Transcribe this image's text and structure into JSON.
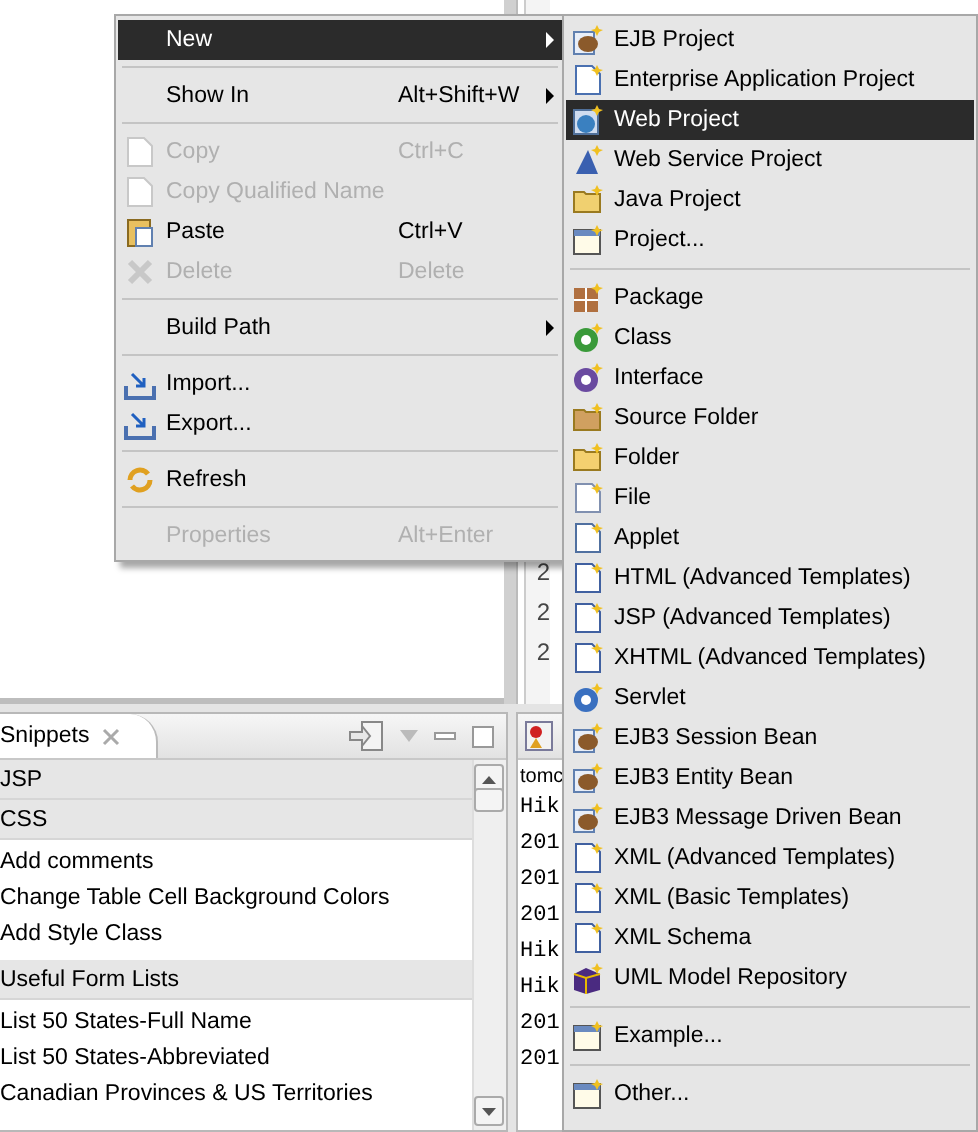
{
  "editor": {
    "line_numbers": [
      "2",
      "2",
      "2"
    ]
  },
  "snippets": {
    "title": "Snippets",
    "categories": [
      {
        "label": "JSP"
      },
      {
        "label": "CSS",
        "items": [
          "Add comments",
          "Change Table Cell Background Colors",
          "Add Style Class"
        ]
      },
      {
        "label": "Useful Form Lists",
        "items": [
          "List 50 States-Full Name",
          "List 50 States-Abbreviated",
          "Canadian Provinces & US Territories"
        ]
      }
    ]
  },
  "console": {
    "lines": [
      "tomc",
      "Hik",
      "201",
      "201",
      "201",
      "Hik",
      "Hik",
      "201",
      "201"
    ]
  },
  "context_menu": {
    "items": [
      {
        "kind": "item",
        "label": "New",
        "submenu": true,
        "disabled": false,
        "selected": true
      },
      {
        "kind": "separator"
      },
      {
        "kind": "item",
        "label": "Show In",
        "shortcut": "Alt+Shift+W",
        "submenu": true,
        "disabled": false,
        "selected": false
      },
      {
        "kind": "separator"
      },
      {
        "kind": "item",
        "label": "Copy",
        "shortcut": "Ctrl+C",
        "submenu": false,
        "disabled": true,
        "selected": false
      },
      {
        "kind": "item",
        "label": "Copy Qualified Name",
        "submenu": false,
        "disabled": true,
        "selected": false
      },
      {
        "kind": "item",
        "label": "Paste",
        "shortcut": "Ctrl+V",
        "submenu": false,
        "disabled": false,
        "selected": false
      },
      {
        "kind": "item",
        "label": "Delete",
        "shortcut": "Delete",
        "submenu": false,
        "disabled": true,
        "selected": false
      },
      {
        "kind": "separator"
      },
      {
        "kind": "item",
        "label": "Build Path",
        "submenu": true,
        "disabled": false,
        "selected": false
      },
      {
        "kind": "separator"
      },
      {
        "kind": "item",
        "label": "Import...",
        "submenu": false,
        "disabled": false,
        "selected": false
      },
      {
        "kind": "item",
        "label": "Export...",
        "submenu": false,
        "disabled": false,
        "selected": false
      },
      {
        "kind": "separator"
      },
      {
        "kind": "item",
        "label": "Refresh",
        "submenu": false,
        "disabled": false,
        "selected": false
      },
      {
        "kind": "separator"
      },
      {
        "kind": "item",
        "label": "Properties",
        "shortcut": "Alt+Enter",
        "submenu": false,
        "disabled": true,
        "selected": false
      }
    ]
  },
  "new_submenu": {
    "items": [
      {
        "kind": "item",
        "label": "EJB Project",
        "selected": false
      },
      {
        "kind": "item",
        "label": "Enterprise Application Project",
        "selected": false
      },
      {
        "kind": "item",
        "label": "Web Project",
        "selected": true
      },
      {
        "kind": "item",
        "label": "Web Service Project",
        "selected": false
      },
      {
        "kind": "item",
        "label": "Java Project",
        "selected": false
      },
      {
        "kind": "item",
        "label": "Project...",
        "selected": false
      },
      {
        "kind": "separator"
      },
      {
        "kind": "item",
        "label": "Package",
        "selected": false
      },
      {
        "kind": "item",
        "label": "Class",
        "selected": false
      },
      {
        "kind": "item",
        "label": "Interface",
        "selected": false
      },
      {
        "kind": "item",
        "label": "Source Folder",
        "selected": false
      },
      {
        "kind": "item",
        "label": "Folder",
        "selected": false
      },
      {
        "kind": "item",
        "label": "File",
        "selected": false
      },
      {
        "kind": "item",
        "label": "Applet",
        "selected": false
      },
      {
        "kind": "item",
        "label": "HTML (Advanced Templates)",
        "selected": false
      },
      {
        "kind": "item",
        "label": "JSP (Advanced Templates)",
        "selected": false
      },
      {
        "kind": "item",
        "label": "XHTML (Advanced Templates)",
        "selected": false
      },
      {
        "kind": "item",
        "label": "Servlet",
        "selected": false
      },
      {
        "kind": "item",
        "label": "EJB3 Session Bean",
        "selected": false
      },
      {
        "kind": "item",
        "label": "EJB3 Entity Bean",
        "selected": false
      },
      {
        "kind": "item",
        "label": "EJB3 Message Driven Bean",
        "selected": false
      },
      {
        "kind": "item",
        "label": "XML (Advanced Templates)",
        "selected": false
      },
      {
        "kind": "item",
        "label": "XML (Basic Templates)",
        "selected": false
      },
      {
        "kind": "item",
        "label": "XML Schema",
        "selected": false
      },
      {
        "kind": "item",
        "label": "UML Model Repository",
        "selected": false
      },
      {
        "kind": "separator"
      },
      {
        "kind": "item",
        "label": "Example...",
        "selected": false
      },
      {
        "kind": "separator"
      },
      {
        "kind": "item",
        "label": "Other...",
        "selected": false
      }
    ]
  }
}
